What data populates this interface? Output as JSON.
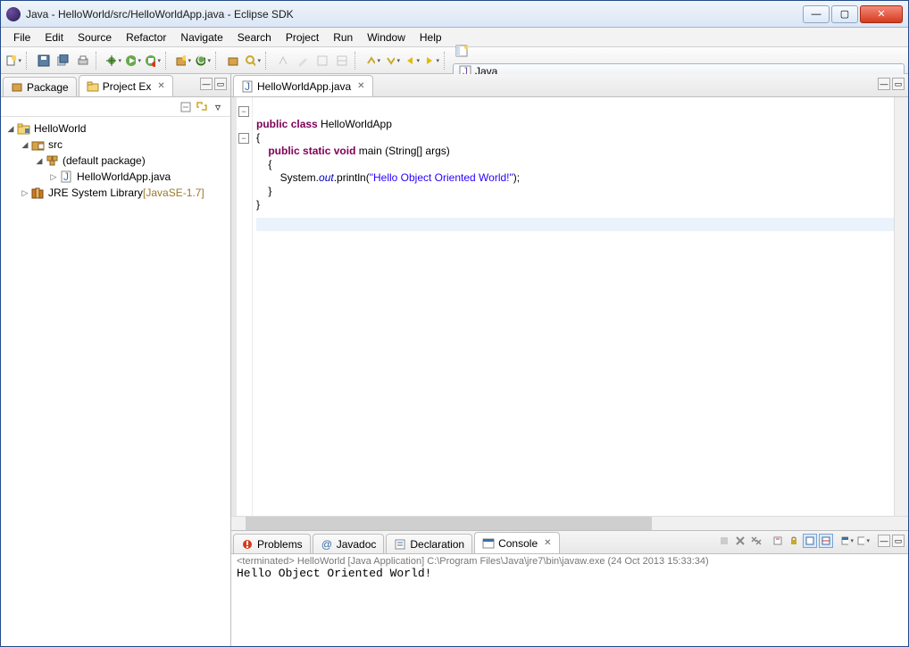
{
  "window": {
    "title": "Java - HelloWorld/src/HelloWorldApp.java - Eclipse SDK"
  },
  "menu": [
    "File",
    "Edit",
    "Source",
    "Refactor",
    "Navigate",
    "Search",
    "Project",
    "Run",
    "Window",
    "Help"
  ],
  "perspective": {
    "label": "Java"
  },
  "left_tabs": {
    "package": "Package",
    "project_ex": "Project Ex"
  },
  "tree": {
    "project": "HelloWorld",
    "src": "src",
    "pkg": "(default package)",
    "file": "HelloWorldApp.java",
    "jre": "JRE System Library",
    "jre_suffix": " [JavaSE-1.7]"
  },
  "editor": {
    "tab": "HelloWorldApp.java",
    "code_tokens": {
      "l1a": "public",
      "l1b": "class",
      "l1c": " HelloWorldApp",
      "l2": "{",
      "l3a": "public",
      "l3b": "static",
      "l3c": "void",
      "l3d": " main (String[] args)",
      "l4": "    {",
      "l5a": "        System.",
      "l5b": "out",
      "l5c": ".println(",
      "l5d": "\"Hello Object Oriented World!\"",
      "l5e": ");",
      "l6": "    }",
      "l7": "}"
    }
  },
  "bottom_tabs": {
    "problems": "Problems",
    "javadoc": "Javadoc",
    "declaration": "Declaration",
    "console": "Console"
  },
  "console": {
    "terminated": "<terminated> HelloWorld [Java Application] C:\\Program Files\\Java\\jre7\\bin\\javaw.exe (24 Oct 2013 15:33:34)",
    "output": "Hello Object Oriented World!"
  }
}
